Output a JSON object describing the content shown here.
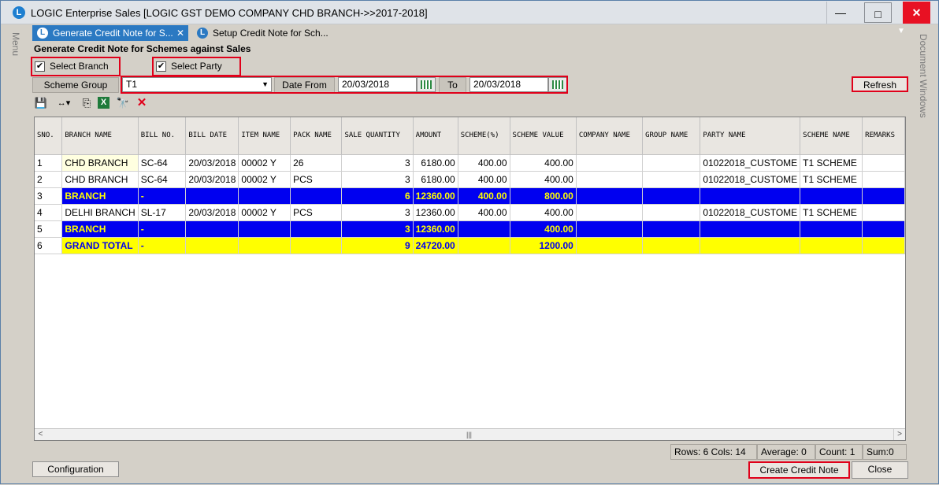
{
  "window": {
    "title": "LOGIC Enterprise Sales  [LOGIC GST DEMO COMPANY CHD BRANCH->>2017-2018]",
    "icon_name": "logic-app-icon",
    "minimize": "—",
    "maximize": "□",
    "close": "✕"
  },
  "side": {
    "left_label": "Menu",
    "right_label": "Document Windows"
  },
  "tabs": [
    {
      "label": "Generate Credit Note for S...",
      "close": "✕"
    },
    {
      "label": "Setup Credit Note for Sch..."
    }
  ],
  "tabs_dropdown": "▼",
  "form": {
    "title": "Generate Credit Note for Schemes against Sales",
    "select_branch": {
      "label": "Select Branch",
      "checked": "✔"
    },
    "select_party": {
      "label": "Select Party",
      "checked": "✔"
    },
    "scheme_group_label": "Scheme Group",
    "scheme_group_value": "T1",
    "date_from_label": "Date From",
    "date_from_value": "20/03/2018",
    "to_label": "To",
    "to_value": "20/03/2018",
    "refresh_label": "Refresh"
  },
  "toolbar": {
    "save": "💾",
    "columns": "↔▾",
    "copy": "⎘",
    "excel": "X",
    "find": "🔭",
    "delete": "✕"
  },
  "grid": {
    "headers": [
      "SNO.",
      "BRANCH NAME",
      "BILL NO.",
      "BILL DATE",
      "ITEM NAME",
      "PACK NAME",
      "SALE QUANTITY",
      "AMOUNT",
      "SCHEME(%)",
      "SCHEME VALUE",
      "COMPANY NAME",
      "GROUP NAME",
      "PARTY NAME",
      "SCHEME NAME",
      "REMARKS"
    ],
    "rows": [
      {
        "type": "data",
        "cells": [
          "1",
          "CHD BRANCH",
          "SC-64",
          "20/03/2018",
          "00002 Y",
          "26",
          "3",
          "6180.00",
          "400.00",
          "400.00",
          "",
          "",
          "01022018_CUSTOME",
          "T1 SCHEME",
          ""
        ]
      },
      {
        "type": "data",
        "cells": [
          "2",
          "CHD BRANCH",
          "SC-64",
          "20/03/2018",
          "00002 Y",
          "PCS",
          "3",
          "6180.00",
          "400.00",
          "400.00",
          "",
          "",
          "01022018_CUSTOME",
          "T1 SCHEME",
          ""
        ]
      },
      {
        "type": "sub",
        "cells": [
          "3",
          "BRANCH",
          "-",
          "",
          "",
          "",
          "6",
          "12360.00",
          "400.00",
          "800.00",
          "",
          "",
          "",
          "",
          ""
        ]
      },
      {
        "type": "data",
        "cells": [
          "4",
          "DELHI BRANCH",
          "SL-17",
          "20/03/2018",
          "00002 Y",
          "PCS",
          "3",
          "12360.00",
          "400.00",
          "400.00",
          "",
          "",
          "01022018_CUSTOME",
          "T1 SCHEME",
          ""
        ]
      },
      {
        "type": "sub",
        "cells": [
          "5",
          "BRANCH",
          "-",
          "",
          "",
          "",
          "3",
          "12360.00",
          "",
          "400.00",
          "",
          "",
          "",
          "",
          ""
        ]
      },
      {
        "type": "grand",
        "cells": [
          "6",
          "GRAND TOTAL",
          "-",
          "",
          "",
          "",
          "9",
          "24720.00",
          "",
          "1200.00",
          "",
          "",
          "",
          "",
          ""
        ]
      }
    ],
    "scroll_left": "<",
    "scroll_right": ">",
    "scroll_grip": "|||"
  },
  "status": {
    "rows_cols": "Rows: 6  Cols: 14",
    "average": "Average: 0",
    "count": "Count: 1",
    "sum": "Sum:0"
  },
  "footer": {
    "configuration_label": "Configuration",
    "create_credit_note_label": "Create Credit Note",
    "close_label": "Close"
  },
  "colors": {
    "subtotal_bg": "#0000f0",
    "subtotal_text": "#ffff00",
    "grandtotal_bg": "#ffff00",
    "grandtotal_text": "#0000f0",
    "highlight_border": "#e0001a",
    "active_tab": "#2b79c2"
  }
}
